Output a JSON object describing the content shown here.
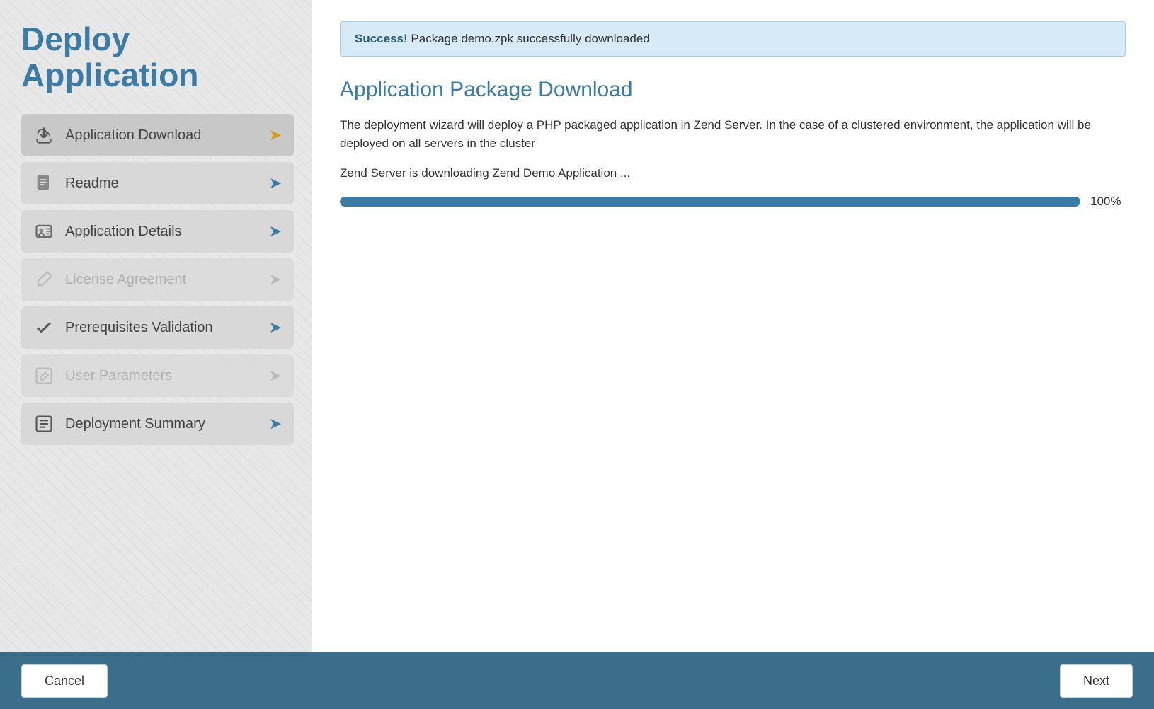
{
  "sidebar": {
    "title": "Deploy\nApplication",
    "title_line1": "Deploy",
    "title_line2": "Application",
    "steps": [
      {
        "id": "application-download",
        "label": "Application Download",
        "icon": "cloud-download",
        "arrow_color": "gold",
        "state": "active",
        "disabled": false
      },
      {
        "id": "readme",
        "label": "Readme",
        "icon": "file",
        "arrow_color": "blue",
        "state": "normal",
        "disabled": false
      },
      {
        "id": "application-details",
        "label": "Application Details",
        "icon": "id-card",
        "arrow_color": "blue",
        "state": "normal",
        "disabled": false
      },
      {
        "id": "license-agreement",
        "label": "License Agreement",
        "icon": "pencil",
        "arrow_color": "gray",
        "state": "normal",
        "disabled": true
      },
      {
        "id": "prerequisites-validation",
        "label": "Prerequisites Validation",
        "icon": "checkmark",
        "arrow_color": "blue",
        "state": "normal",
        "disabled": false
      },
      {
        "id": "user-parameters",
        "label": "User Parameters",
        "icon": "edit-box",
        "arrow_color": "gray",
        "state": "normal",
        "disabled": true
      },
      {
        "id": "deployment-summary",
        "label": "Deployment Summary",
        "icon": "list",
        "arrow_color": "blue",
        "state": "normal",
        "disabled": false
      }
    ]
  },
  "main": {
    "success_banner": {
      "bold": "Success!",
      "text": " Package demo.zpk successfully downloaded"
    },
    "section_title": "Application Package Download",
    "description": "The deployment wizard will deploy a PHP packaged application in Zend Server. In the case of a clustered environment, the application will be deployed on all servers in the cluster",
    "download_status": "Zend Server is downloading Zend Demo Application ...",
    "progress": {
      "value": 100,
      "label": "100%"
    }
  },
  "footer": {
    "cancel_label": "Cancel",
    "next_label": "Next"
  }
}
